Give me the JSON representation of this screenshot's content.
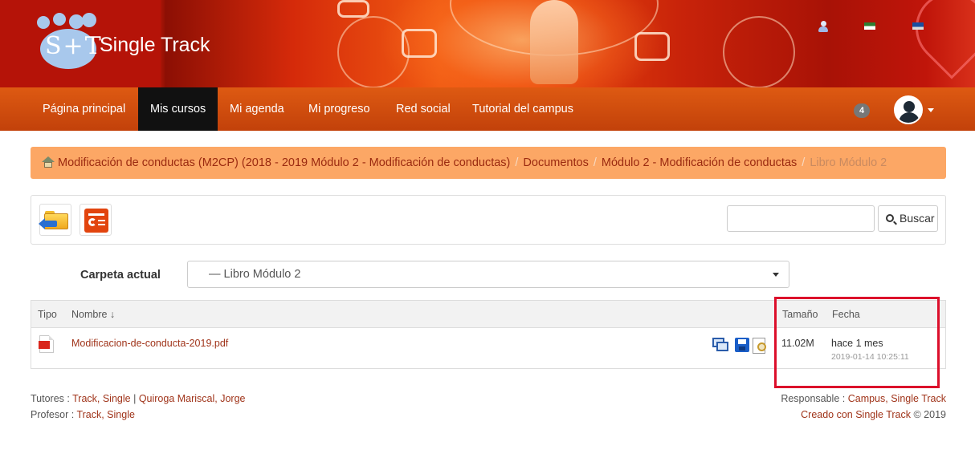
{
  "header": {
    "brand": "Single Track",
    "logo_text": "S+T",
    "icons": [
      "user-icon",
      "language-flag-icon",
      "language-flag-icon"
    ]
  },
  "nav": {
    "items": [
      {
        "label": "Página principal"
      },
      {
        "label": "Mis cursos",
        "active": true
      },
      {
        "label": "Mi agenda"
      },
      {
        "label": "Mi progreso"
      },
      {
        "label": "Red social"
      },
      {
        "label": "Tutorial del campus"
      }
    ],
    "notifications_count": "4"
  },
  "breadcrumb": {
    "items": [
      "Modificación de conductas (M2CP) (2018 - 2019 Módulo 2 - Modificación de conductas)",
      "Documentos",
      "Módulo 2 - Modificación de conductas"
    ],
    "current": "Libro Módulo 2",
    "separator": "/"
  },
  "toolbar": {
    "search_value": "",
    "search_button_label": "Buscar"
  },
  "folder": {
    "label": "Carpeta actual",
    "selected": "— Libro Módulo 2"
  },
  "table": {
    "columns": {
      "type": "Tipo",
      "name": "Nombre ↓",
      "size": "Tamaño",
      "date": "Fecha"
    },
    "rows": [
      {
        "icon": "pdf-icon",
        "name": "Modificacion-de-conducta-2019.pdf",
        "size": "11.02M",
        "date_relative": "hace 1 mes",
        "date_absolute": "2019-01-14 10:25:11"
      }
    ]
  },
  "footer": {
    "tutors_label": "Tutores :",
    "tutor_1": "Track, Single",
    "tutor_sep": "|",
    "tutor_2": "Quiroga Mariscal, Jorge",
    "professor_label": "Profesor :",
    "professor": "Track, Single",
    "responsible_label": "Responsable :",
    "responsible": "Campus, Single Track",
    "created_label": "Creado con Single Track",
    "copyright": "© 2019"
  },
  "colors": {
    "nav_bg": "#c94a0c",
    "nav_active": "#111111",
    "breadcrumb_bg": "#fca765",
    "link": "#a0341a",
    "highlight": "#dc0f2b"
  }
}
